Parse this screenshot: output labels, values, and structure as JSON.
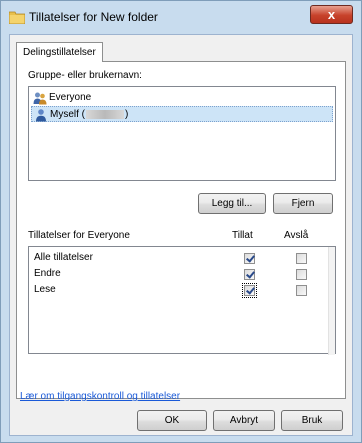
{
  "window": {
    "title": "Tillatelser for New folder",
    "close_label": "x"
  },
  "tabs": [
    {
      "label": "Delingstillatelser",
      "selected": true
    }
  ],
  "users": {
    "label": "Gruppe- eller brukernavn:",
    "items": [
      {
        "name": "Everyone",
        "icon": "group-icon",
        "selected": false
      },
      {
        "name_prefix": "Myself (",
        "name_suffix": ")",
        "icon": "user-icon",
        "selected": true
      }
    ]
  },
  "user_buttons": {
    "add_label": "Legg til...",
    "remove_label": "Fjern"
  },
  "permissions": {
    "header_label": "Tillatelser for Everyone",
    "allow_header": "Tillat",
    "deny_header": "Avslå",
    "rows": [
      {
        "name": "Alle tillatelser",
        "allow": true,
        "deny": false
      },
      {
        "name": "Endre",
        "allow": true,
        "deny": false
      },
      {
        "name": "Lese",
        "allow": true,
        "deny": false
      }
    ]
  },
  "help_link": "Lær om tilgangskontroll og tillatelser",
  "dialog_buttons": {
    "ok_label": "OK",
    "cancel_label": "Avbryt",
    "apply_label": "Bruk"
  },
  "colors": {
    "frame": "#c8dcee",
    "selection": "#cde4f7",
    "link": "#1a5ad8",
    "close_button": "#c7422b"
  }
}
